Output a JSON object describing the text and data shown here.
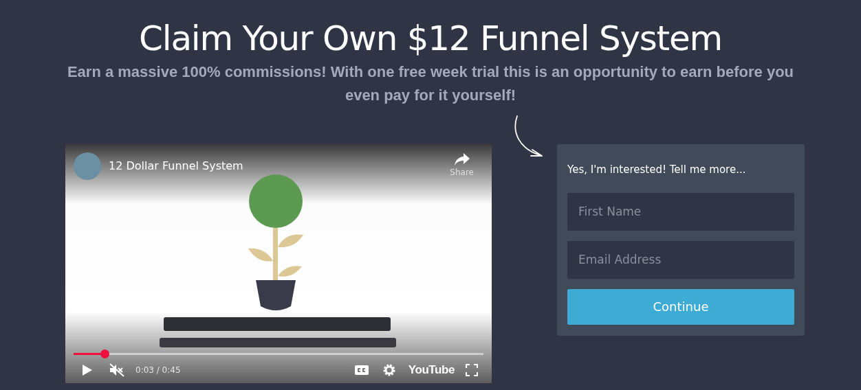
{
  "headline": "Claim Your Own $12 Funnel System",
  "subheadline": "Earn a massive 100% commissions! With one free week trial this is an opportunity to earn before you even pay for it yourself!",
  "video": {
    "channel_title": "12 Dollar Funnel System",
    "share_label": "Share",
    "progress": {
      "level": 0.077
    },
    "time": "0:03 / 0:45",
    "muted": true,
    "logo_text": "YouTube"
  },
  "form": {
    "heading": "Yes, I'm interested! Tell me more...",
    "fields": [
      {
        "placeholder": "First Name"
      },
      {
        "placeholder": "Email Address"
      }
    ],
    "submit": "Continue"
  }
}
